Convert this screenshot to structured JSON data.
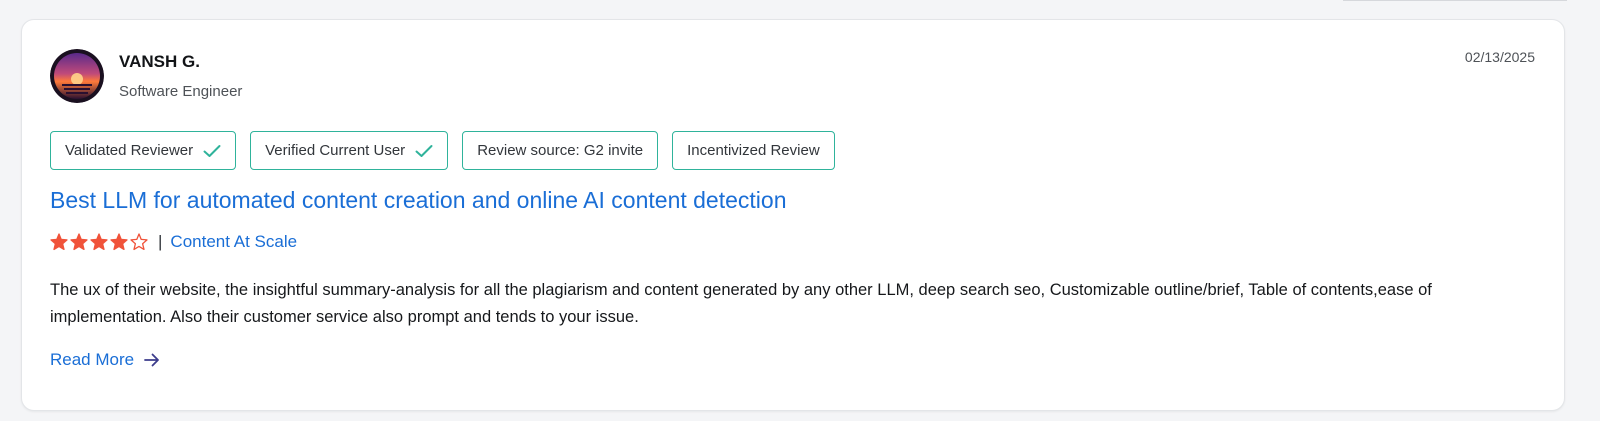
{
  "review": {
    "reviewer_name": "VANSH G.",
    "reviewer_role": "Software Engineer",
    "date": "02/13/2025",
    "badges": [
      {
        "label": "Validated Reviewer",
        "checked": true
      },
      {
        "label": "Verified Current User",
        "checked": true
      },
      {
        "label": "Review source: G2 invite",
        "checked": false
      },
      {
        "label": "Incentivized Review",
        "checked": false
      }
    ],
    "title": "Best LLM for automated content creation and online AI content detection",
    "rating": 4,
    "rating_max": 5,
    "separator": "|",
    "product": "Content At Scale",
    "body": "The ux of their website, the insightful summary-analysis for all the plagiarism and content generated by any other LLM, deep search seo, Customizable outline/brief, Table of contents,ease of implementation. Also their customer service also prompt and tends to your issue.",
    "read_more": "Read More"
  },
  "colors": {
    "badge_border": "#2fb39b",
    "link": "#1a6ed6",
    "star": "#f0533a"
  },
  "icons": {
    "badge_check": "check-icon",
    "read_more": "arrow-right-icon",
    "avatar": "avatar"
  }
}
